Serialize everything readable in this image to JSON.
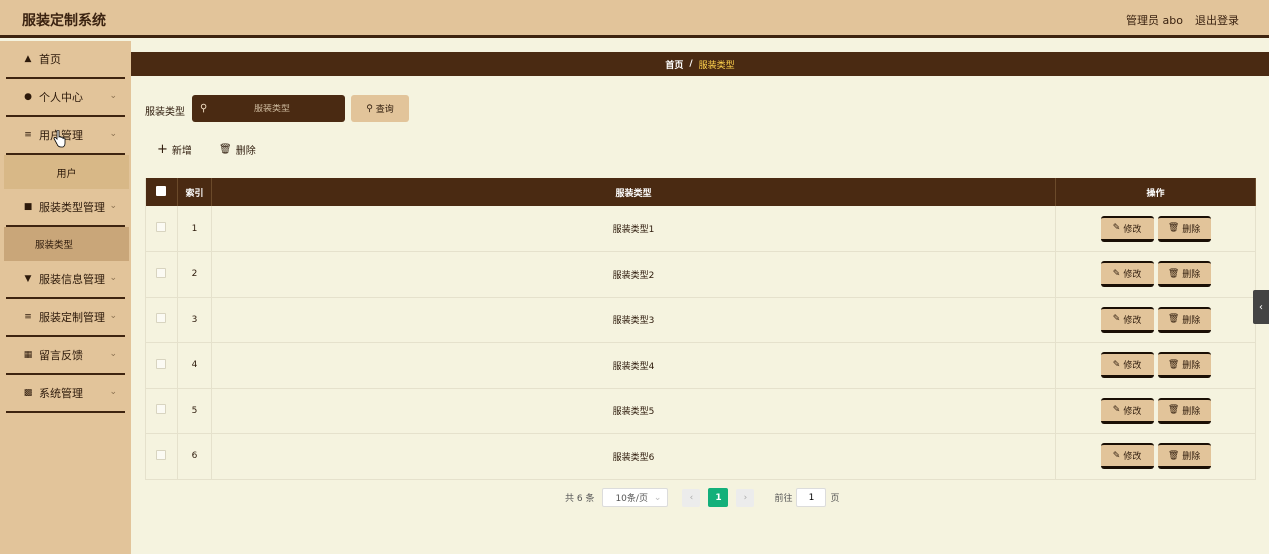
{
  "header": {
    "app_title": "服装定制系统",
    "user_label": "管理员 abo",
    "logout_label": "退出登录"
  },
  "sidebar": {
    "items": [
      {
        "label": "首页",
        "icon": "home-icon"
      },
      {
        "label": "个人中心",
        "icon": "user-icon"
      },
      {
        "label": "用户管理",
        "icon": "sliders-icon"
      },
      {
        "label": "服装类型管理",
        "icon": "briefcase-icon"
      },
      {
        "label": "服装信息管理",
        "icon": "tag-icon"
      },
      {
        "label": "服装定制管理",
        "icon": "list-icon"
      },
      {
        "label": "留言反馈",
        "icon": "grid-icon"
      },
      {
        "label": "系统管理",
        "icon": "apps-icon"
      }
    ],
    "sub_user": "用户",
    "sub_type": "服装类型"
  },
  "breadcrumb": {
    "home": "首页",
    "sep": "/",
    "current": "服装类型"
  },
  "search": {
    "label": "服装类型",
    "placeholder": "服装类型",
    "query_label": "查询"
  },
  "actions": {
    "add_label": "新增",
    "delete_label": "删除"
  },
  "table": {
    "headers": {
      "index": "索引",
      "type": "服装类型",
      "op": "操作"
    },
    "rows": [
      {
        "index": "1",
        "type": "服装类型1"
      },
      {
        "index": "2",
        "type": "服装类型2"
      },
      {
        "index": "3",
        "type": "服装类型3"
      },
      {
        "index": "4",
        "type": "服装类型4"
      },
      {
        "index": "5",
        "type": "服装类型5"
      },
      {
        "index": "6",
        "type": "服装类型6"
      }
    ],
    "edit_label": "修改",
    "row_delete_label": "删除"
  },
  "pagination": {
    "total": "共 6 条",
    "page_size": "10条/页",
    "current_page": "1",
    "goto_label": "前往",
    "goto_value": "1",
    "page_suffix": "页"
  }
}
